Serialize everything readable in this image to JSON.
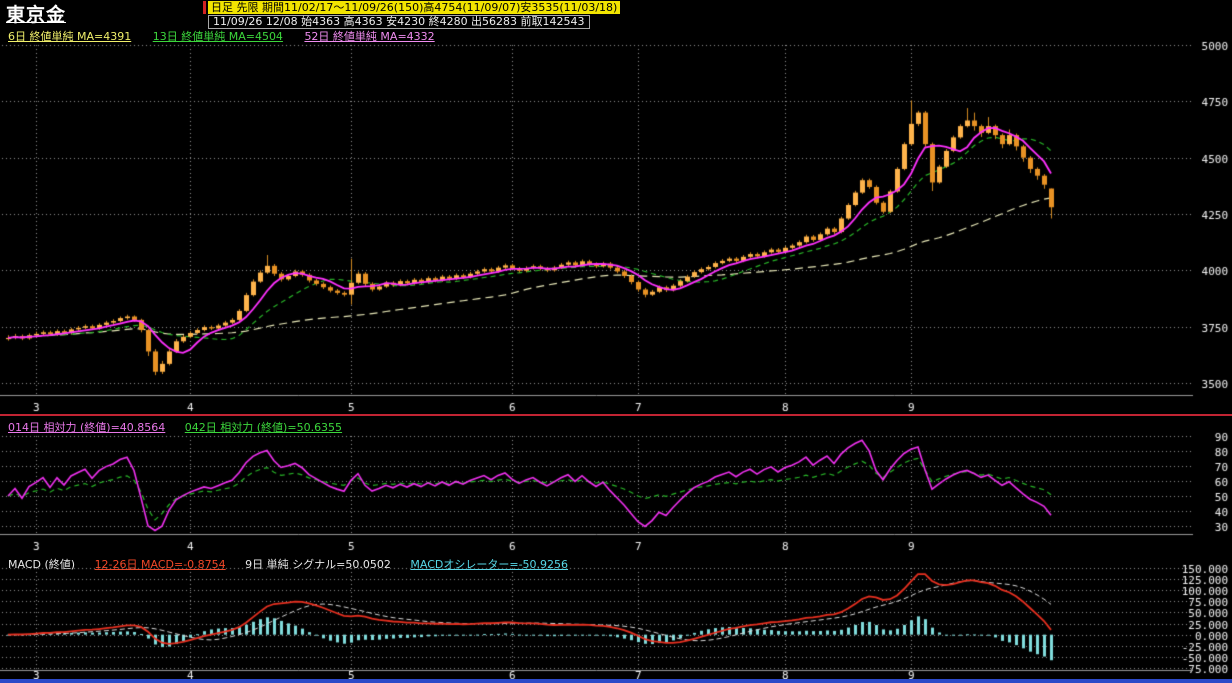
{
  "header": {
    "title": "東京金",
    "info_line1": "日足 先限 期間11/02/17～11/09/26(150)高4754(11/09/07)安3535(11/03/18)",
    "info_line2": "11/09/26 12/08 始4363 高4363 安4230 終4280 出56283 前取142543",
    "ma_legend": [
      {
        "label": "6日 終値単純 MA=4391",
        "color": "#f0ef6a"
      },
      {
        "label": "13日 終値単純 MA=4504",
        "color": "#3cd63c"
      },
      {
        "label": "52日 終値単純 MA=4332",
        "color": "#ef8cef"
      }
    ]
  },
  "rsi_header": {
    "fast_label": "014日 相対力 (終値)=40.8564",
    "fast_color": "#e878e8",
    "slow_label": "042日 相対力 (終値)=50.6355",
    "slow_color": "#3cd63c"
  },
  "macd_header": {
    "title_label": "MACD (終値)",
    "title_color": "#e8e8e8",
    "macd_label": "12-26日 MACD=-0.8754",
    "macd_color": "#f04828",
    "signal_label": "9日 単純 シグナル=50.0502",
    "signal_color": "#e8e8e8",
    "osc_label": "MACDオシレーター=-50.9256",
    "osc_color": "#58d8e8"
  },
  "colors": {
    "background": "#000000",
    "candle_up": "#ffb44c",
    "candle_down": "#e89224",
    "candle_wick": "#d08820",
    "ma_fast": "#ff30ff",
    "ma_mid": "#28b428",
    "ma_slow": "#e8e8b8",
    "rsi_fast": "#f030f0",
    "rsi_slow": "#28b428",
    "macd_line": "#e83020",
    "macd_signal": "#d8d8d8",
    "macd_hist": "#80dcdc",
    "grid": "#909090",
    "axis_text": "#f0f0f0",
    "separator": "#c22433",
    "highlight_bg": "#f2e400",
    "bottom_bar": "#2b49c8"
  },
  "chart_data": [
    {
      "type": "candlestick",
      "title": "東京金 日足 先限",
      "period": "11/02/17～11/09/26",
      "bars": 150,
      "period_high": 4754,
      "period_high_date": "11/09/07",
      "period_low": 3535,
      "period_low_date": "11/03/18",
      "latest": {
        "date": "11/09/26",
        "contract": "12/08",
        "open": 4363,
        "high": 4363,
        "low": 4230,
        "close": 4280,
        "volume": 56283,
        "open_interest": 142543
      },
      "ma_series": [
        {
          "name": "6日 終値単純",
          "period": 6,
          "value": 4391
        },
        {
          "name": "13日 終値単純",
          "period": 13,
          "value": 4504
        },
        {
          "name": "52日 終値単純",
          "period": 52,
          "value": 4332
        }
      ],
      "x_tick_labels": [
        "3",
        "4",
        "5",
        "6",
        "7",
        "8",
        "9"
      ],
      "month_tick_indices": [
        4,
        26,
        49,
        72,
        90,
        111,
        129
      ],
      "y_tick_values": [
        5000,
        4750,
        4500,
        4250,
        4000,
        3750,
        3500
      ],
      "y_tick_labels": [
        "5000",
        "4750",
        "4500",
        "4250",
        "4000",
        "3750",
        "3500"
      ],
      "ylim": [
        3450,
        5022
      ],
      "ohlc": [
        [
          3695,
          3712,
          3688,
          3700
        ],
        [
          3700,
          3718,
          3694,
          3708
        ],
        [
          3708,
          3715,
          3690,
          3698
        ],
        [
          3698,
          3720,
          3692,
          3712
        ],
        [
          3712,
          3728,
          3705,
          3718
        ],
        [
          3718,
          3733,
          3712,
          3725
        ],
        [
          3725,
          3732,
          3708,
          3715
        ],
        [
          3715,
          3738,
          3709,
          3730
        ],
        [
          3730,
          3737,
          3715,
          3722
        ],
        [
          3722,
          3745,
          3716,
          3738
        ],
        [
          3738,
          3753,
          3731,
          3745
        ],
        [
          3745,
          3760,
          3739,
          3752
        ],
        [
          3752,
          3759,
          3735,
          3742
        ],
        [
          3742,
          3765,
          3736,
          3758
        ],
        [
          3758,
          3776,
          3752,
          3768
        ],
        [
          3768,
          3783,
          3762,
          3775
        ],
        [
          3775,
          3795,
          3769,
          3788
        ],
        [
          3788,
          3803,
          3781,
          3795
        ],
        [
          3795,
          3800,
          3772,
          3780
        ],
        [
          3780,
          3785,
          3725,
          3735
        ],
        [
          3735,
          3740,
          3620,
          3640
        ],
        [
          3640,
          3650,
          3535,
          3550
        ],
        [
          3550,
          3598,
          3540,
          3585
        ],
        [
          3585,
          3650,
          3578,
          3640
        ],
        [
          3640,
          3695,
          3633,
          3685
        ],
        [
          3685,
          3713,
          3678,
          3705
        ],
        [
          3705,
          3730,
          3699,
          3722
        ],
        [
          3722,
          3743,
          3716,
          3735
        ],
        [
          3735,
          3756,
          3729,
          3748
        ],
        [
          3748,
          3755,
          3735,
          3742
        ],
        [
          3742,
          3763,
          3736,
          3755
        ],
        [
          3755,
          3776,
          3749,
          3768
        ],
        [
          3768,
          3788,
          3762,
          3780
        ],
        [
          3780,
          3828,
          3774,
          3820
        ],
        [
          3820,
          3900,
          3814,
          3890
        ],
        [
          3890,
          3960,
          3884,
          3950
        ],
        [
          3950,
          4000,
          3944,
          3990
        ],
        [
          3990,
          4068,
          3984,
          4020
        ],
        [
          4020,
          4028,
          3975,
          3985
        ],
        [
          3985,
          3992,
          3950,
          3960
        ],
        [
          3960,
          3983,
          3954,
          3975
        ],
        [
          3975,
          4003,
          3969,
          3995
        ],
        [
          3995,
          4002,
          3972,
          3980
        ],
        [
          3980,
          3987,
          3946,
          3955
        ],
        [
          3955,
          3962,
          3932,
          3940
        ],
        [
          3940,
          3947,
          3917,
          3925
        ],
        [
          3925,
          3932,
          3902,
          3910
        ],
        [
          3910,
          3917,
          3892,
          3900
        ],
        [
          3900,
          3907,
          3884,
          3892
        ],
        [
          3892,
          4052,
          3848,
          3945
        ],
        [
          3945,
          3995,
          3938,
          3985
        ],
        [
          3985,
          3992,
          3930,
          3940
        ],
        [
          3940,
          3947,
          3906,
          3915
        ],
        [
          3915,
          3936,
          3909,
          3928
        ],
        [
          3928,
          3953,
          3922,
          3945
        ],
        [
          3945,
          3952,
          3927,
          3935
        ],
        [
          3935,
          3960,
          3929,
          3952
        ],
        [
          3952,
          3959,
          3934,
          3942
        ],
        [
          3942,
          3966,
          3936,
          3958
        ],
        [
          3958,
          3965,
          3940,
          3948
        ],
        [
          3948,
          3973,
          3942,
          3965
        ],
        [
          3965,
          3972,
          3947,
          3955
        ],
        [
          3955,
          3980,
          3949,
          3972
        ],
        [
          3972,
          3979,
          3954,
          3962
        ],
        [
          3962,
          3986,
          3956,
          3978
        ],
        [
          3978,
          3985,
          3962,
          3970
        ],
        [
          3970,
          3993,
          3964,
          3985
        ],
        [
          3985,
          4003,
          3979,
          3995
        ],
        [
          3995,
          4013,
          3989,
          4005
        ],
        [
          4005,
          4012,
          3987,
          3995
        ],
        [
          3995,
          4020,
          3989,
          4012
        ],
        [
          4012,
          4030,
          4006,
          4022
        ],
        [
          4022,
          4029,
          4000,
          4008
        ],
        [
          4008,
          4015,
          3990,
          3998
        ],
        [
          3998,
          4018,
          3992,
          4010
        ],
        [
          4010,
          4026,
          4004,
          4018
        ],
        [
          4018,
          4025,
          4000,
          4008
        ],
        [
          4008,
          4015,
          3992,
          4000
        ],
        [
          4000,
          4020,
          3994,
          4012
        ],
        [
          4012,
          4033,
          4006,
          4025
        ],
        [
          4025,
          4043,
          4019,
          4035
        ],
        [
          4035,
          4042,
          4014,
          4022
        ],
        [
          4022,
          4048,
          4016,
          4040
        ],
        [
          4040,
          4047,
          4020,
          4028
        ],
        [
          4028,
          4035,
          4010,
          4018
        ],
        [
          4018,
          4038,
          4012,
          4030
        ],
        [
          4030,
          4037,
          4004,
          4012
        ],
        [
          4012,
          4019,
          3987,
          3995
        ],
        [
          3995,
          4002,
          3966,
          3975
        ],
        [
          3975,
          3982,
          3938,
          3948
        ],
        [
          3948,
          3955,
          3905,
          3915
        ],
        [
          3915,
          3922,
          3880,
          3892
        ],
        [
          3892,
          3913,
          3886,
          3905
        ],
        [
          3905,
          3933,
          3899,
          3925
        ],
        [
          3925,
          3932,
          3904,
          3912
        ],
        [
          3912,
          3940,
          3906,
          3932
        ],
        [
          3932,
          3960,
          3926,
          3952
        ],
        [
          3952,
          3980,
          3946,
          3972
        ],
        [
          3972,
          4000,
          3966,
          3992
        ],
        [
          3992,
          4013,
          3986,
          4005
        ],
        [
          4005,
          4023,
          3999,
          4015
        ],
        [
          4015,
          4040,
          4009,
          4032
        ],
        [
          4032,
          4050,
          4026,
          4042
        ],
        [
          4042,
          4060,
          4036,
          4052
        ],
        [
          4052,
          4059,
          4034,
          4042
        ],
        [
          4042,
          4068,
          4036,
          4060
        ],
        [
          4060,
          4080,
          4054,
          4072
        ],
        [
          4072,
          4079,
          4054,
          4062
        ],
        [
          4062,
          4088,
          4056,
          4080
        ],
        [
          4080,
          4100,
          4074,
          4092
        ],
        [
          4092,
          4099,
          4074,
          4082
        ],
        [
          4082,
          4108,
          4076,
          4100
        ],
        [
          4100,
          4118,
          4092,
          4110
        ],
        [
          4110,
          4133,
          4104,
          4125
        ],
        [
          4125,
          4158,
          4119,
          4150
        ],
        [
          4150,
          4157,
          4127,
          4135
        ],
        [
          4135,
          4168,
          4129,
          4160
        ],
        [
          4160,
          4193,
          4154,
          4185
        ],
        [
          4185,
          4192,
          4162,
          4170
        ],
        [
          4170,
          4238,
          4164,
          4230
        ],
        [
          4230,
          4298,
          4224,
          4290
        ],
        [
          4290,
          4353,
          4284,
          4345
        ],
        [
          4345,
          4408,
          4339,
          4400
        ],
        [
          4400,
          4407,
          4362,
          4370
        ],
        [
          4370,
          4377,
          4292,
          4300
        ],
        [
          4300,
          4307,
          4252,
          4260
        ],
        [
          4260,
          4358,
          4254,
          4350
        ],
        [
          4350,
          4458,
          4344,
          4450
        ],
        [
          4450,
          4568,
          4444,
          4560
        ],
        [
          4560,
          4754,
          4554,
          4650
        ],
        [
          4650,
          4708,
          4640,
          4700
        ],
        [
          4700,
          4707,
          4548,
          4560
        ],
        [
          4560,
          4567,
          4352,
          4390
        ],
        [
          4390,
          4468,
          4384,
          4460
        ],
        [
          4460,
          4538,
          4454,
          4530
        ],
        [
          4530,
          4598,
          4524,
          4590
        ],
        [
          4590,
          4648,
          4584,
          4640
        ],
        [
          4640,
          4720,
          4634,
          4665
        ],
        [
          4665,
          4700,
          4620,
          4640
        ],
        [
          4640,
          4647,
          4592,
          4610
        ],
        [
          4610,
          4680,
          4604,
          4640
        ],
        [
          4640,
          4647,
          4582,
          4600
        ],
        [
          4600,
          4607,
          4542,
          4560
        ],
        [
          4560,
          4625,
          4554,
          4600
        ],
        [
          4600,
          4607,
          4532,
          4550
        ],
        [
          4550,
          4557,
          4482,
          4500
        ],
        [
          4500,
          4507,
          4432,
          4450
        ],
        [
          4450,
          4457,
          4402,
          4420
        ],
        [
          4420,
          4427,
          4362,
          4380
        ],
        [
          4363,
          4363,
          4230,
          4280
        ]
      ]
    },
    {
      "type": "line",
      "name": "相対力 (RSI)",
      "series": [
        {
          "name": "014日 相対力 (終値)",
          "period": 14,
          "last_value": 40.8564
        },
        {
          "name": "042日 相対力 (終値)",
          "period": 42,
          "last_value": 50.6355
        }
      ],
      "x_tick_labels": [
        "3",
        "4",
        "5",
        "6",
        "7",
        "8",
        "9"
      ],
      "y_tick_values": [
        90,
        80,
        70,
        60,
        50,
        40,
        30
      ],
      "y_tick_labels": [
        "90",
        "80",
        "70",
        "60",
        "50",
        "40",
        "30"
      ],
      "ylim": [
        25,
        95
      ]
    },
    {
      "type": "macd",
      "name": "MACD (終値)",
      "params": {
        "fast": 12,
        "slow": 26,
        "signal_period": 9,
        "signal_type": "単純"
      },
      "last_values": {
        "macd": -0.8754,
        "signal": 50.0502,
        "oscillator": -50.9256
      },
      "x_tick_labels": [
        "3",
        "4",
        "5",
        "6",
        "7",
        "8",
        "9"
      ],
      "y_tick_values": [
        150,
        125,
        100,
        75,
        50,
        25,
        0,
        -25,
        -50,
        -75
      ],
      "y_tick_labels": [
        "150.000",
        "125.000",
        "100.000",
        "75.000",
        "50.000",
        "25.000",
        "0.000",
        "-25.000",
        "-50.000",
        "-75.000"
      ],
      "ylim": [
        -80,
        155
      ]
    }
  ]
}
